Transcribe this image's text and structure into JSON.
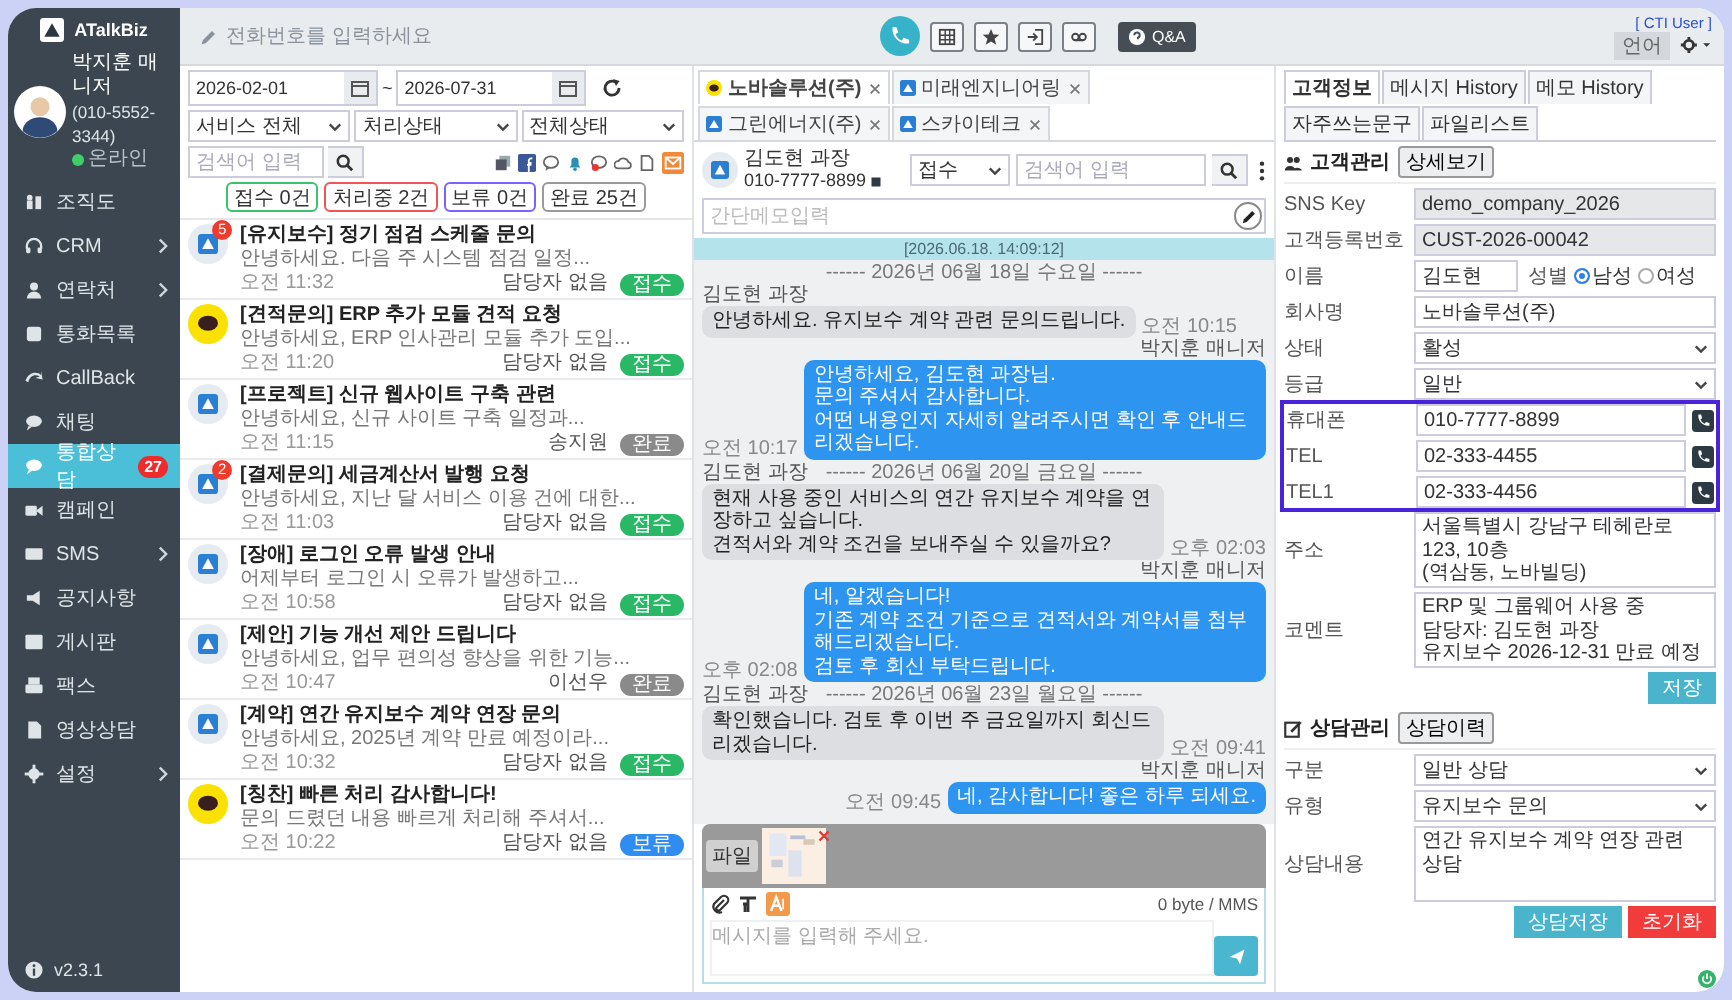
{
  "topbar": {
    "phone_placeholder": "전화번호를 입력하세요",
    "qa_label": "Q&A",
    "cti_label": "[ CTI User ]",
    "language_label": "언어"
  },
  "sidebar": {
    "logo": "ATalkBiz",
    "user": {
      "name": "박지훈 매니저",
      "phone": "(010-5552-3344)",
      "status": "온라인",
      "online": true
    },
    "items": [
      {
        "label": "조직도",
        "selected": false,
        "submenu": false
      },
      {
        "label": "CRM",
        "selected": false,
        "submenu": true
      },
      {
        "label": "연락처",
        "selected": false,
        "submenu": true
      },
      {
        "label": "통화목록",
        "selected": false,
        "submenu": false
      },
      {
        "label": "CallBack",
        "selected": false,
        "submenu": false
      },
      {
        "label": "채팅",
        "selected": false,
        "submenu": false
      },
      {
        "label": "통합상담",
        "selected": true,
        "submenu": false,
        "badge": "27"
      },
      {
        "label": "캠페인",
        "selected": false,
        "submenu": false
      },
      {
        "label": "SMS",
        "selected": false,
        "submenu": true
      },
      {
        "label": "공지사항",
        "selected": false,
        "submenu": false
      },
      {
        "label": "게시판",
        "selected": false,
        "submenu": false
      },
      {
        "label": "팩스",
        "selected": false,
        "submenu": false
      },
      {
        "label": "영상상담",
        "selected": false,
        "submenu": false
      },
      {
        "label": "설정",
        "selected": false,
        "submenu": true
      }
    ],
    "version": "v2.3.1"
  },
  "inquiries": {
    "date_from": "2026-02-01",
    "date_separator": "~",
    "date_to": "2026-07-31",
    "filters": [
      "서비스 전체",
      "처리상태",
      "전체상태"
    ],
    "search_placeholder": "검색어 입력",
    "counts": [
      {
        "label": "접수 0건",
        "color": "#3cc26b"
      },
      {
        "label": "처리중 2건",
        "color": "#f0555a"
      },
      {
        "label": "보류 0건",
        "color": "#7b61ff"
      },
      {
        "label": "완료 25건",
        "color": "#9a9a9a"
      }
    ],
    "items": [
      {
        "kind": "atalk",
        "unread": "5",
        "title": "[유지보수] 정기 점검 스케줄 문의",
        "preview": "안녕하세요. 다음 주 시스템 점검 일정...",
        "time": "오전 11:32",
        "assignee": "담당자 없음",
        "status": {
          "label": "접수",
          "color": "#29b865"
        }
      },
      {
        "kind": "kakao",
        "title": "[견적문의] ERP 추가 모듈 견적 요청",
        "preview": "안녕하세요, ERP 인사관리 모듈 추가 도입...",
        "time": "오전 11:20",
        "assignee": "담당자 없음",
        "status": {
          "label": "접수",
          "color": "#29b865"
        }
      },
      {
        "kind": "atalk",
        "title": "[프로젝트] 신규 웹사이트 구축 관련",
        "preview": "안녕하세요, 신규 사이트 구축 일정과...",
        "time": "오전 11:15",
        "assignee": "송지원",
        "status": {
          "label": "완료",
          "color": "#8a8a8a"
        }
      },
      {
        "kind": "atalk",
        "unread": "2",
        "title": "[결제문의] 세금계산서 발행 요청",
        "preview": "안녕하세요, 지난 달 서비스 이용 건에 대한...",
        "time": "오전 11:03",
        "assignee": "담당자 없음",
        "status": {
          "label": "접수",
          "color": "#29b865"
        }
      },
      {
        "kind": "atalk",
        "title": "[장애] 로그인 오류 발생 안내",
        "preview": "어제부터 로그인 시 오류가 발생하고...",
        "time": "오전 10:58",
        "assignee": "담당자 없음",
        "status": {
          "label": "접수",
          "color": "#29b865"
        }
      },
      {
        "kind": "atalk",
        "title": "[제안] 기능 개선 제안 드립니다",
        "preview": "안녕하세요, 업무 편의성 향상을 위한 기능...",
        "time": "오전 10:47",
        "assignee": "이선우",
        "status": {
          "label": "완료",
          "color": "#8a8a8a"
        }
      },
      {
        "kind": "atalk",
        "title": "[계약] 연간 유지보수 계약 연장 문의",
        "preview": "안녕하세요, 2025년 계약 만료 예정이라...",
        "time": "오전 10:32",
        "assignee": "담당자 없음",
        "status": {
          "label": "접수",
          "color": "#29b865"
        }
      },
      {
        "kind": "kakao",
        "title": "[칭찬] 빠른 처리 감사합니다!",
        "preview": "문의 드렸던 내용 빠르게 처리해 주셔서...",
        "time": "오전 10:22",
        "assignee": "담당자 없음",
        "status": {
          "label": "보류",
          "color": "#2f8cf0"
        }
      }
    ]
  },
  "chat": {
    "tabs": [
      {
        "label": "노바솔루션(주)",
        "kind": "kakao",
        "selected": true
      },
      {
        "label": "미래엔지니어링",
        "kind": "atalk",
        "selected": false
      },
      {
        "label": "그린에너지(주)",
        "kind": "atalk",
        "selected": false
      },
      {
        "label": "스카이테크",
        "kind": "atalk",
        "selected": false
      }
    ],
    "contact": {
      "name": "김도현 과장",
      "phone": "010-7777-8899"
    },
    "status_select": "접수",
    "search_placeholder": "검색어 입력",
    "memo_placeholder": "간단메모입력",
    "banner": "[2026.06.18. 14:09:12]",
    "messages": [
      {
        "kind": "date",
        "text": "------ 2026년 06월 18일 수요일 ------"
      },
      {
        "kind": "in",
        "sender": "김도현 과장",
        "text": "안녕하세요. 유지보수 계약 관련 문의드립니다.",
        "time": "오전 10:15"
      },
      {
        "kind": "out",
        "sender": "박지훈 매니저",
        "text": "안녕하세요, 김도현 과장님.\n문의 주셔서 감사합니다.\n어떤 내용인지 자세히 알려주시면 확인 후 안내드리겠습니다.",
        "time": "오전 10:17"
      },
      {
        "kind": "date",
        "sender": "김도현 과장",
        "text": "------ 2026년 06월 20일 금요일 ------"
      },
      {
        "kind": "in",
        "text": "현재 사용 중인 서비스의 연간 유지보수 계약을 연장하고 싶습니다.\n견적서와 계약 조건을 보내주실 수 있을까요?",
        "time": "오후 02:03"
      },
      {
        "kind": "out",
        "sender": "박지훈 매니저",
        "text": "네, 알겠습니다!\n기존 계약 조건 기준으로 견적서와 계약서를 첨부해드리겠습니다.\n검토 후 회신 부탁드립니다.",
        "time": "오후 02:08"
      },
      {
        "kind": "date",
        "sender": "김도현 과장",
        "text": "------ 2026년 06월 23일 월요일 ------"
      },
      {
        "kind": "in",
        "text": "확인했습니다. 검토 후 이번 주 금요일까지 회신드리겠습니다.",
        "time": "오전 09:41"
      },
      {
        "kind": "out",
        "sender": "박지훈 매니저",
        "text": "네, 감사합니다! 좋은 하루 되세요.",
        "time": "오전 09:45"
      }
    ],
    "attachment_label": "파일",
    "byte_count": "0 byte / MMS",
    "input_placeholder": "메시지를 입력해 주세요."
  },
  "customer": {
    "tabs": [
      {
        "label": "고객정보",
        "selected": true
      },
      {
        "label": "메시지 History",
        "selected": false
      },
      {
        "label": "메모 History",
        "selected": false
      },
      {
        "label": "자주쓰는문구",
        "selected": false
      },
      {
        "label": "파일리스트",
        "selected": false
      }
    ],
    "title": "고객관리",
    "detail_button": "상세보기",
    "fields": [
      {
        "label": "SNS Key",
        "value": "demo_company_2026",
        "kind": "readonly"
      },
      {
        "label": "고객등록번호",
        "value": "CUST-2026-00042",
        "kind": "readonly"
      },
      {
        "label": "이름",
        "value": "김도현",
        "kind": "name"
      },
      {
        "label": "회사명",
        "value": "노바솔루션(주)",
        "kind": "text"
      },
      {
        "label": "상태",
        "value": "활성",
        "kind": "select"
      },
      {
        "label": "등급",
        "value": "일반",
        "kind": "select"
      }
    ],
    "gender": {
      "label": "성별",
      "options": [
        {
          "label": "남성",
          "selected": true
        },
        {
          "label": "여성",
          "selected": false
        }
      ]
    },
    "phones": {
      "highlighted": true,
      "fields": [
        {
          "label": "휴대폰",
          "value": "010-7777-8899"
        },
        {
          "label": "TEL",
          "value": "02-333-4455"
        },
        {
          "label": "TEL1",
          "value": "02-333-4456"
        }
      ]
    },
    "address": {
      "label": "주소",
      "value": "서울특별시 강남구 테헤란로 123, 10층\n(역삼동, 노바빌딩)"
    },
    "comment": {
      "label": "코멘트",
      "value": "ERP 및 그룹웨어 사용 중\n담당자: 김도현 과장\n유지보수 2026-12-31 만료 예정"
    },
    "save_button": "저장",
    "consult": {
      "title": "상담관리",
      "history_button": "상담이력",
      "fields": [
        {
          "label": "구분",
          "value": "일반 상담",
          "kind": "select"
        },
        {
          "label": "유형",
          "value": "유지보수 문의",
          "kind": "select"
        },
        {
          "label": "상담내용",
          "value": "연간 유지보수 계약 연장 관련 상담",
          "kind": "textarea"
        }
      ],
      "save_button": "상담저장",
      "reset_button": "초기화"
    }
  }
}
